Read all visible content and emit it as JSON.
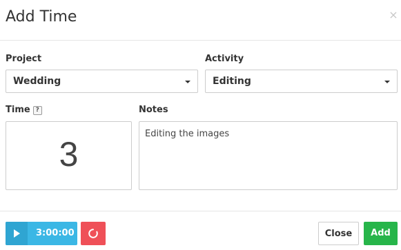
{
  "header": {
    "title": "Add Time",
    "close_glyph": "×"
  },
  "project": {
    "label": "Project",
    "value": "Wedding"
  },
  "activity": {
    "label": "Activity",
    "value": "Editing"
  },
  "time": {
    "label": "Time",
    "help": "?",
    "value": "3"
  },
  "notes": {
    "label": "Notes",
    "value": "Editing the images"
  },
  "footer": {
    "timer_value": "3:00:00",
    "close_label": "Close",
    "add_label": "Add"
  },
  "icons": {
    "play": "play-icon",
    "reset": "refresh-icon",
    "close": "close-icon",
    "caret": "chevron-down-icon",
    "help": "help-icon"
  },
  "colors": {
    "timer": "#3bb7e5",
    "reset": "#ef5058",
    "add": "#27b54a"
  }
}
